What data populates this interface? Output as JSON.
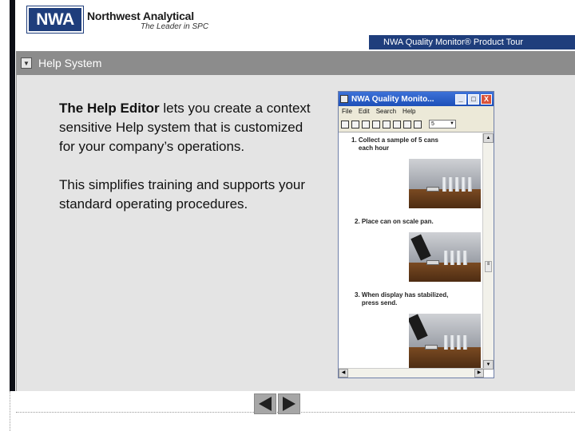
{
  "brand": {
    "logo_text": "NWA",
    "company": "Northwest Analytical",
    "tagline": "The Leader in SPC"
  },
  "tour_title": "NWA Quality Monitor® Product Tour",
  "help_bar": {
    "label": "Help System",
    "icon": "collapse-arrow-icon"
  },
  "content": {
    "paragraph1_bold": "The Help Editor",
    "paragraph1_rest": " lets you create a context sensitive Help system that is customized for your company’s operations.",
    "paragraph2": "This simplifies training and supports your standard operating procedures."
  },
  "help_window": {
    "title": "NWA Quality Monito...",
    "buttons": {
      "minimize": "_",
      "maximize": "□",
      "close": "X"
    },
    "menu": [
      "File",
      "Edit",
      "Search",
      "Help"
    ],
    "toolbar_select_value": "5",
    "steps": [
      {
        "text": "1. Collect a sample of 5 cans\n    each hour"
      },
      {
        "text": "2. Place can on scale pan."
      },
      {
        "text": "3. When display has stabilized,\n    press send."
      }
    ]
  },
  "nav": {
    "prev_icon": "triangle-left-icon",
    "next_icon": "triangle-right-icon"
  },
  "colors": {
    "brand_blue": "#1f3e7c",
    "help_bar_gray": "#8c8c8c",
    "content_bg": "#e4e4e4",
    "titlebar_blue": "#2a5fc8"
  }
}
